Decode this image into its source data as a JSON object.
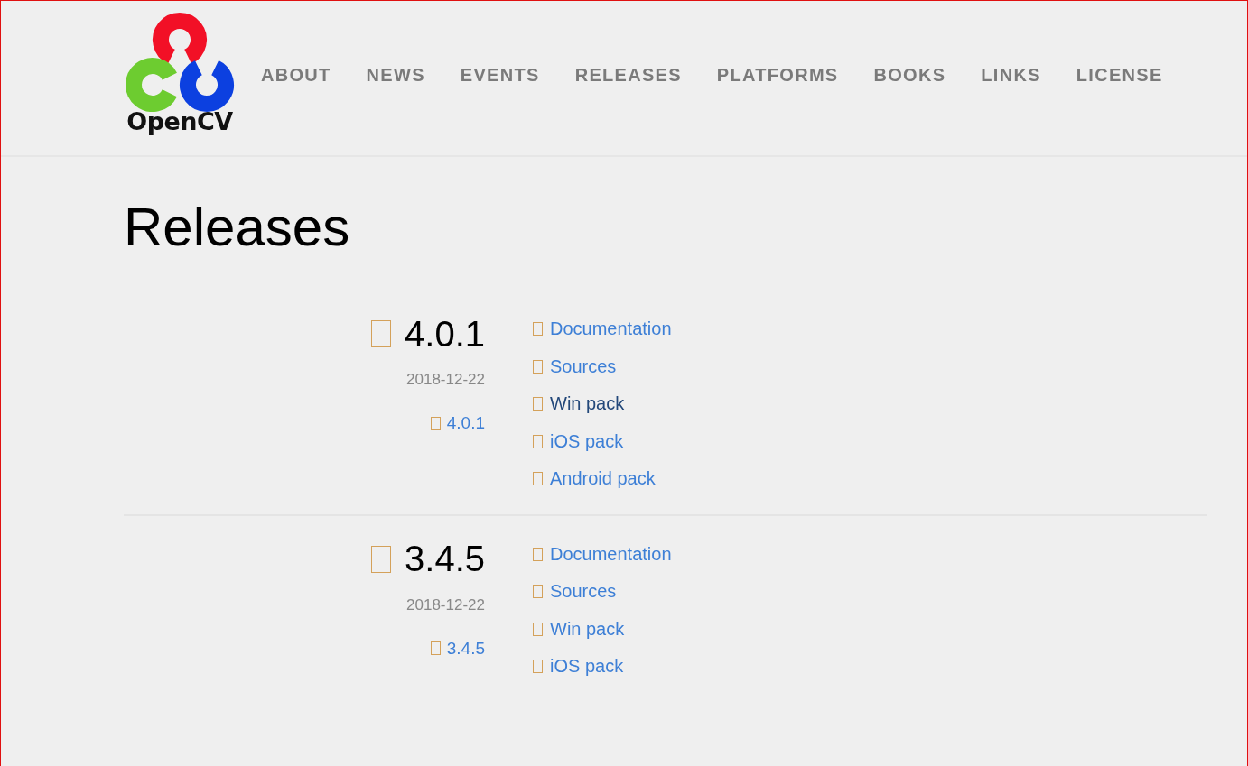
{
  "logo": {
    "text": "OpenCV"
  },
  "nav": [
    {
      "label": "ABOUT"
    },
    {
      "label": "NEWS"
    },
    {
      "label": "EVENTS"
    },
    {
      "label": "RELEASES"
    },
    {
      "label": "PLATFORMS"
    },
    {
      "label": "BOOKS"
    },
    {
      "label": "LINKS"
    },
    {
      "label": "LICENSE"
    }
  ],
  "page_title": "Releases",
  "releases": [
    {
      "version": "4.0.1",
      "date": "2018-12-22",
      "version_link": "4.0.1",
      "links": [
        {
          "label": "Documentation",
          "hovered": false
        },
        {
          "label": "Sources",
          "hovered": false
        },
        {
          "label": "Win pack",
          "hovered": true
        },
        {
          "label": "iOS pack",
          "hovered": false
        },
        {
          "label": "Android pack",
          "hovered": false
        }
      ]
    },
    {
      "version": "3.4.5",
      "date": "2018-12-22",
      "version_link": "3.4.5",
      "links": [
        {
          "label": "Documentation",
          "hovered": false
        },
        {
          "label": "Sources",
          "hovered": false
        },
        {
          "label": "Win pack",
          "hovered": false
        },
        {
          "label": "iOS pack",
          "hovered": false
        }
      ]
    }
  ]
}
